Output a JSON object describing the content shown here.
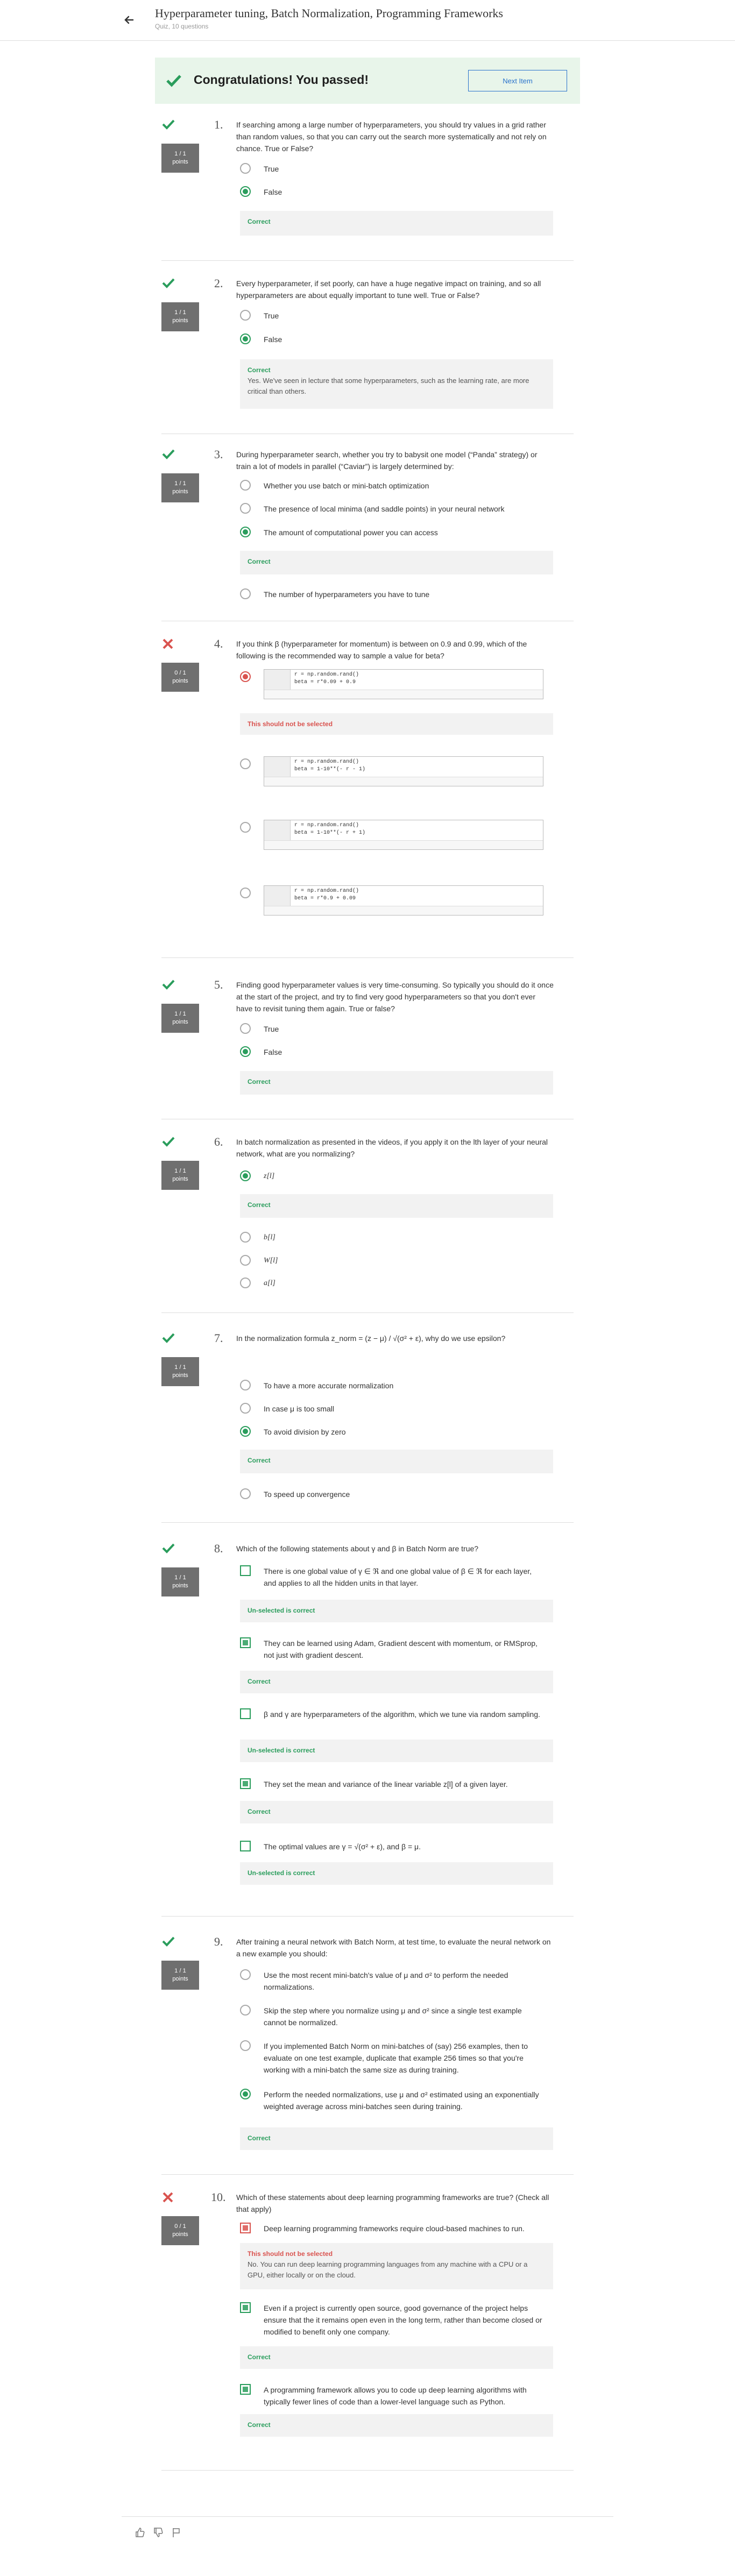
{
  "header": {
    "title": "Hyperparameter tuning, Batch Normalization, Programming Frameworks",
    "subtitle": "Quiz, 10 questions"
  },
  "banner": {
    "text": "Congratulations! You passed!",
    "button": "Next Item"
  },
  "points_full": "1 / 1\npoints",
  "points_zero": "0 / 1\npoints",
  "questions": [
    {
      "num": "1.",
      "text": "If searching among a large number of hyperparameters, you should try values in a grid rather than random values, so that you can carry out the search more systematically and not rely on chance. True or False?",
      "options": [
        "True",
        "False"
      ],
      "feedback": "Correct"
    },
    {
      "num": "2.",
      "text": "Every hyperparameter, if set poorly, can have a huge negative impact on training, and so all hyperparameters are about equally important to tune well. True or False?",
      "options": [
        "True",
        "False"
      ],
      "feedback": "Correct",
      "feedback_body": "Yes. We've seen in lecture that some hyperparameters, such as the learning rate, are more critical than others."
    },
    {
      "num": "3.",
      "text": "During hyperparameter search, whether you try to babysit one model (“Panda” strategy) or train a lot of models in parallel (“Caviar”) is largely determined by:",
      "options": [
        "Whether you use batch or mini-batch optimization",
        "The presence of local minima (and saddle points) in your neural network",
        "The amount of computational power you can access",
        "The number of hyperparameters you have to tune"
      ],
      "feedback": "Correct"
    },
    {
      "num": "4.",
      "text": "If you think β (hyperparameter for momentum) is between on 0.9 and 0.99, which of the following is the recommended way to sample a value for beta?",
      "code_l1": "r = np.random.rand()",
      "codes": [
        "beta = r*0.09 + 0.9",
        "beta = 1-10**(- r - 1)",
        "beta = 1-10**(- r + 1)",
        "beta = r*0.9 + 0.09"
      ],
      "feedback": "This should not be selected"
    },
    {
      "num": "5.",
      "text": "Finding good hyperparameter values is very time-consuming. So typically you should do it once at the start of the project, and try to find very good hyperparameters so that you don't ever have to revisit tuning them again. True or false?",
      "options": [
        "True",
        "False"
      ],
      "feedback": "Correct"
    },
    {
      "num": "6.",
      "text": "In batch normalization as presented in the videos, if you apply it on the lth layer of your neural network, what are you normalizing?",
      "options": [
        "z[l]",
        "b[l]",
        "W[l]",
        "a[l]"
      ],
      "feedback": "Correct"
    },
    {
      "num": "7.",
      "text": "In the normalization formula z_norm = (z − μ) / √(σ² + ε), why do we use epsilon?",
      "options": [
        "To have a more accurate normalization",
        "In case μ is too small",
        "To avoid division by zero",
        "To speed up convergence"
      ],
      "feedback": "Correct"
    },
    {
      "num": "8.",
      "text": "Which of the following statements about γ and β in Batch Norm are true?",
      "options": [
        "There is one global value of γ ∈ ℜ and one global value of β ∈ ℜ for each layer, and applies to all the hidden units in that layer.",
        "They can be learned using Adam, Gradient descent with momentum, or RMSprop, not just with gradient descent.",
        "β and γ are hyperparameters of the algorithm, which we tune via random sampling.",
        "They set the mean and variance of the linear variable z[l] of a given layer.",
        "The optimal values are γ = √(σ² + ε), and β = μ."
      ],
      "feedbacks": [
        "Un-selected is correct",
        "Correct",
        "Un-selected is correct",
        "Correct",
        "Un-selected is correct"
      ]
    },
    {
      "num": "9.",
      "text": "After training a neural network with Batch Norm, at test time, to evaluate the neural network on a new example you should:",
      "options": [
        "Use the most recent mini-batch's value of μ and σ² to perform the needed normalizations.",
        "Skip the step where you normalize using μ and σ² since a single test example cannot be normalized.",
        "If you implemented Batch Norm on mini-batches of (say) 256 examples, then to evaluate on one test example, duplicate that example 256 times so that you're working with a mini-batch the same size as during training.",
        "Perform the needed normalizations, use μ and σ² estimated using an exponentially weighted average across mini-batches seen during training."
      ],
      "feedback": "Correct"
    },
    {
      "num": "10.",
      "text": "Which of these statements about deep learning programming frameworks are true? (Check all that apply)",
      "options": [
        "Deep learning programming frameworks require cloud-based machines to run.",
        "Even if a project is currently open source, good governance of the project helps ensure that the it remains open even in the long term, rather than become closed or modified to benefit only one company.",
        "A programming framework allows you to code up deep learning algorithms with typically fewer lines of code than a lower-level language such as Python."
      ],
      "feedbacks": [
        "This should not be selected",
        "Correct",
        "Correct"
      ],
      "feedback_body_0": "No. You can run deep learning programming languages from any machine with a CPU or a GPU, either locally or on the cloud."
    }
  ]
}
